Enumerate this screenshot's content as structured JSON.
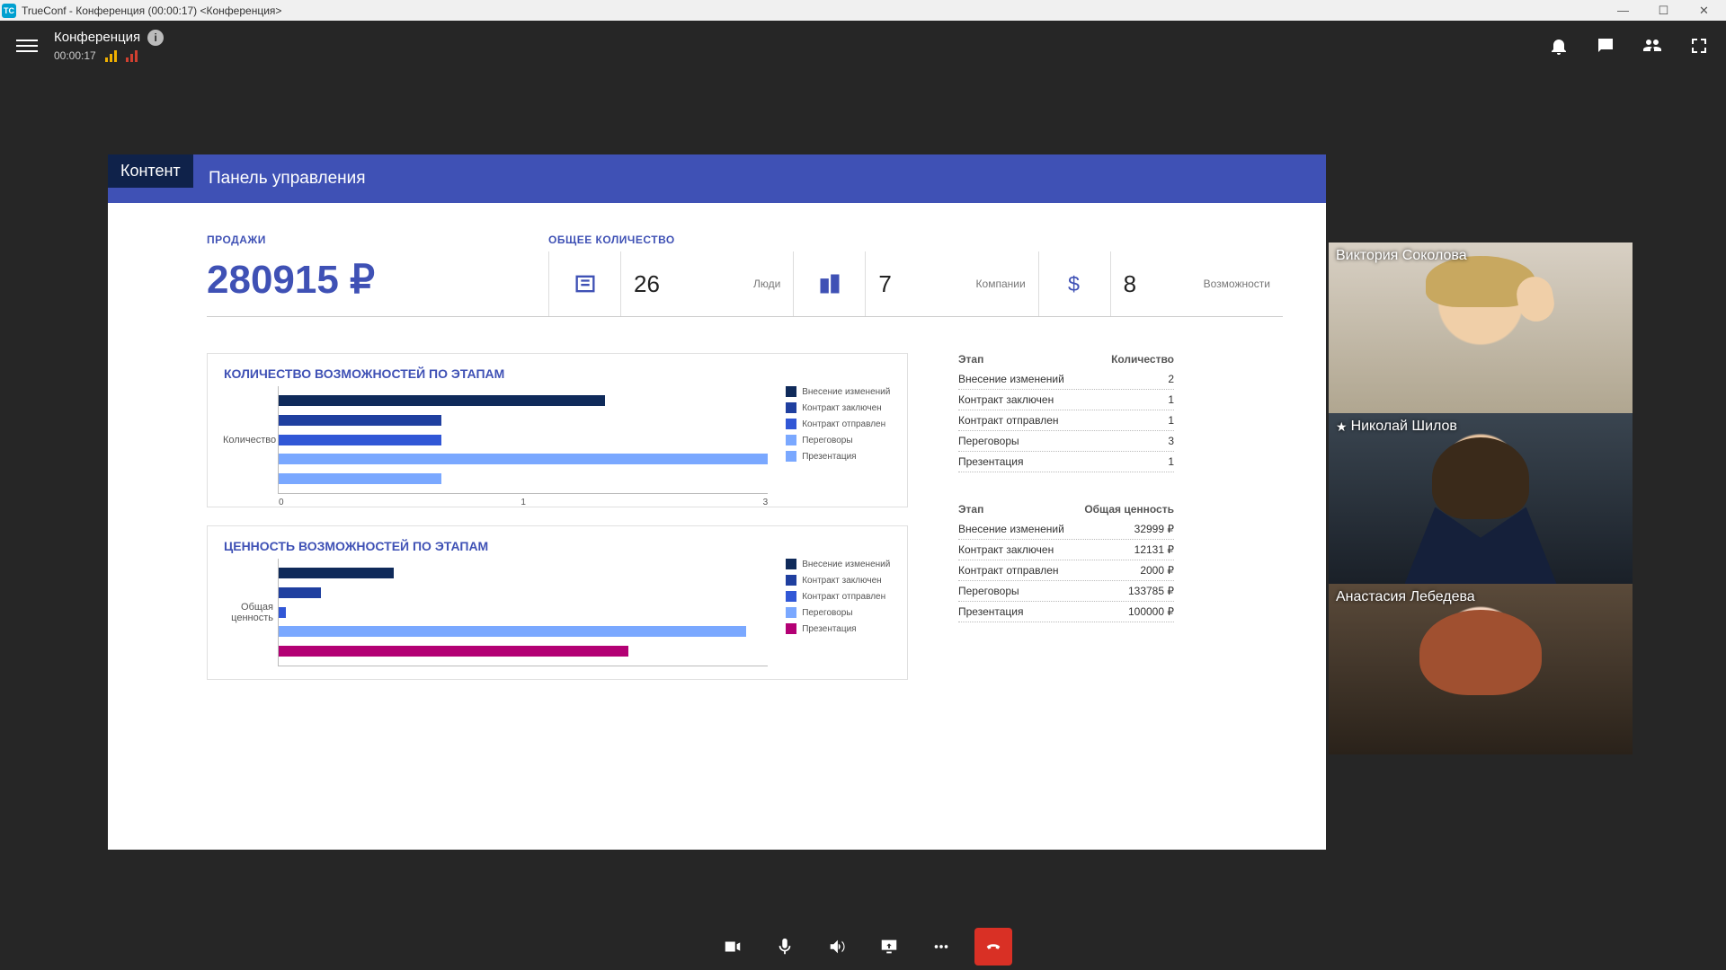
{
  "window": {
    "title": "TrueConf - Конференция (00:00:17) <Конференция>",
    "app_abbr": "TC"
  },
  "header": {
    "title": "Конференция",
    "timer": "00:00:17"
  },
  "content_tag": "Контент",
  "dashboard": {
    "title": "Панель управления",
    "sales_label": "ПРОДАЖИ",
    "sales_value": "280915 ₽",
    "total_label": "ОБЩЕЕ КОЛИЧЕСТВО",
    "kpis": [
      {
        "value": "26",
        "label": "Люди"
      },
      {
        "value": "7",
        "label": "Компании"
      },
      {
        "value": "8",
        "label": "Возможности"
      }
    ]
  },
  "chart_data": [
    {
      "type": "bar",
      "orientation": "horizontal",
      "title": "КОЛИЧЕСТВО ВОЗМОЖНОСТЕЙ ПО ЭТАПАМ",
      "ylabel": "Количество",
      "xlim": [
        0,
        3
      ],
      "xticks": [
        "0",
        "1",
        "3"
      ],
      "categories": [
        "Внесение изменений",
        "Контракт заключен",
        "Контракт отправлен",
        "Переговоры",
        "Презентация"
      ],
      "values": [
        2,
        1,
        1,
        3,
        1
      ],
      "colors": [
        "#0f2a5a",
        "#1f3f9f",
        "#3157d6",
        "#7aa8ff",
        "#7aa8ff"
      ]
    },
    {
      "type": "bar",
      "orientation": "horizontal",
      "title": "ЦЕННОСТЬ ВОЗМОЖНОСТЕЙ ПО ЭТАПАМ",
      "ylabel": "Общая ценность",
      "xlim": [
        0,
        140000
      ],
      "categories": [
        "Внесение изменений",
        "Контракт заключен",
        "Контракт отправлен",
        "Переговоры",
        "Презентация"
      ],
      "values": [
        32999,
        12131,
        2000,
        133785,
        100000
      ],
      "colors": [
        "#0f2a5a",
        "#1f3f9f",
        "#3157d6",
        "#7aa8ff",
        "#b30074"
      ]
    }
  ],
  "table1": {
    "headers": [
      "Этап",
      "Количество"
    ],
    "rows": [
      [
        "Внесение изменений",
        "2"
      ],
      [
        "Контракт заключен",
        "1"
      ],
      [
        "Контракт отправлен",
        "1"
      ],
      [
        "Переговоры",
        "3"
      ],
      [
        "Презентация",
        "1"
      ]
    ]
  },
  "table2": {
    "headers": [
      "Этап",
      "Общая ценность"
    ],
    "rows": [
      [
        "Внесение изменений",
        "32999 ₽"
      ],
      [
        "Контракт заключен",
        "12131 ₽"
      ],
      [
        "Контракт отправлен",
        "2000 ₽"
      ],
      [
        "Переговоры",
        "133785 ₽"
      ],
      [
        "Презентация",
        "100000 ₽"
      ]
    ]
  },
  "participants": [
    {
      "name": "Виктория Соколова",
      "host": false
    },
    {
      "name": "Николай Шилов",
      "host": true
    },
    {
      "name": "Анастасия Лебедева",
      "host": false
    }
  ],
  "legend": {
    "items": [
      "Внесение изменений",
      "Контракт заключен",
      "Контракт отправлен",
      "Переговоры",
      "Презентация"
    ]
  }
}
